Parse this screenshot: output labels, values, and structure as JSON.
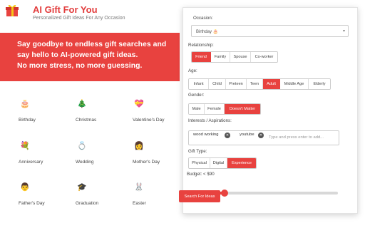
{
  "brand": {
    "title": "AI Gift For You",
    "subtitle": "Personalized Gift Ideas For Any Occasion",
    "logo_icon": "gift-box-icon"
  },
  "banner": {
    "line1": "Say goodbye to endless gift searches and",
    "line2": "say hello to AI-powered gift ideas.",
    "line3": "No more stress, no more guessing."
  },
  "occasions": [
    {
      "label": "Birthday",
      "icon": "🎂"
    },
    {
      "label": "Christmas",
      "icon": "🎄"
    },
    {
      "label": "Valentine's Day",
      "icon": "💝"
    },
    {
      "label": "Anniversary",
      "icon": "💐"
    },
    {
      "label": "Wedding",
      "icon": "💍"
    },
    {
      "label": "Mother's Day",
      "icon": "👩"
    },
    {
      "label": "Father's Day",
      "icon": "👨"
    },
    {
      "label": "Graduation",
      "icon": "🎓"
    },
    {
      "label": "Easter",
      "icon": "🐰"
    }
  ],
  "form": {
    "occasion_label": "Occasion:",
    "occasion_value": "Birthday 🎂",
    "relationship_label": "Relationship:",
    "relationship_options": [
      "Friend",
      "Family",
      "Spouse",
      "Co-worker"
    ],
    "relationship_selected": "Friend",
    "age_label": "Age:",
    "age_options": [
      "Infant",
      "Child",
      "Preteen",
      "Teen",
      "Adult",
      "Middle Age",
      "Elderly"
    ],
    "age_selected": "Adult",
    "gender_label": "Gender:",
    "gender_options": [
      "Male",
      "Female",
      "Doesn't Matter"
    ],
    "gender_selected": "Doesn't Matter",
    "interests_label": "Interests / Aspirations:",
    "interests_tags": [
      "wood working",
      "youtube"
    ],
    "interests_placeholder": "Type and press enter to add...",
    "gift_type_label": "Gift Type:",
    "gift_type_options": [
      "Physical",
      "Digital",
      "Experience"
    ],
    "gift_type_selected": "Experience",
    "budget_label": "Budget: < $90",
    "budget_value": 90,
    "budget_fraction": 0.27,
    "submit_label": "Search For Ideas"
  },
  "colors": {
    "accent": "#e8423f",
    "brand_text": "#e23c3c"
  }
}
